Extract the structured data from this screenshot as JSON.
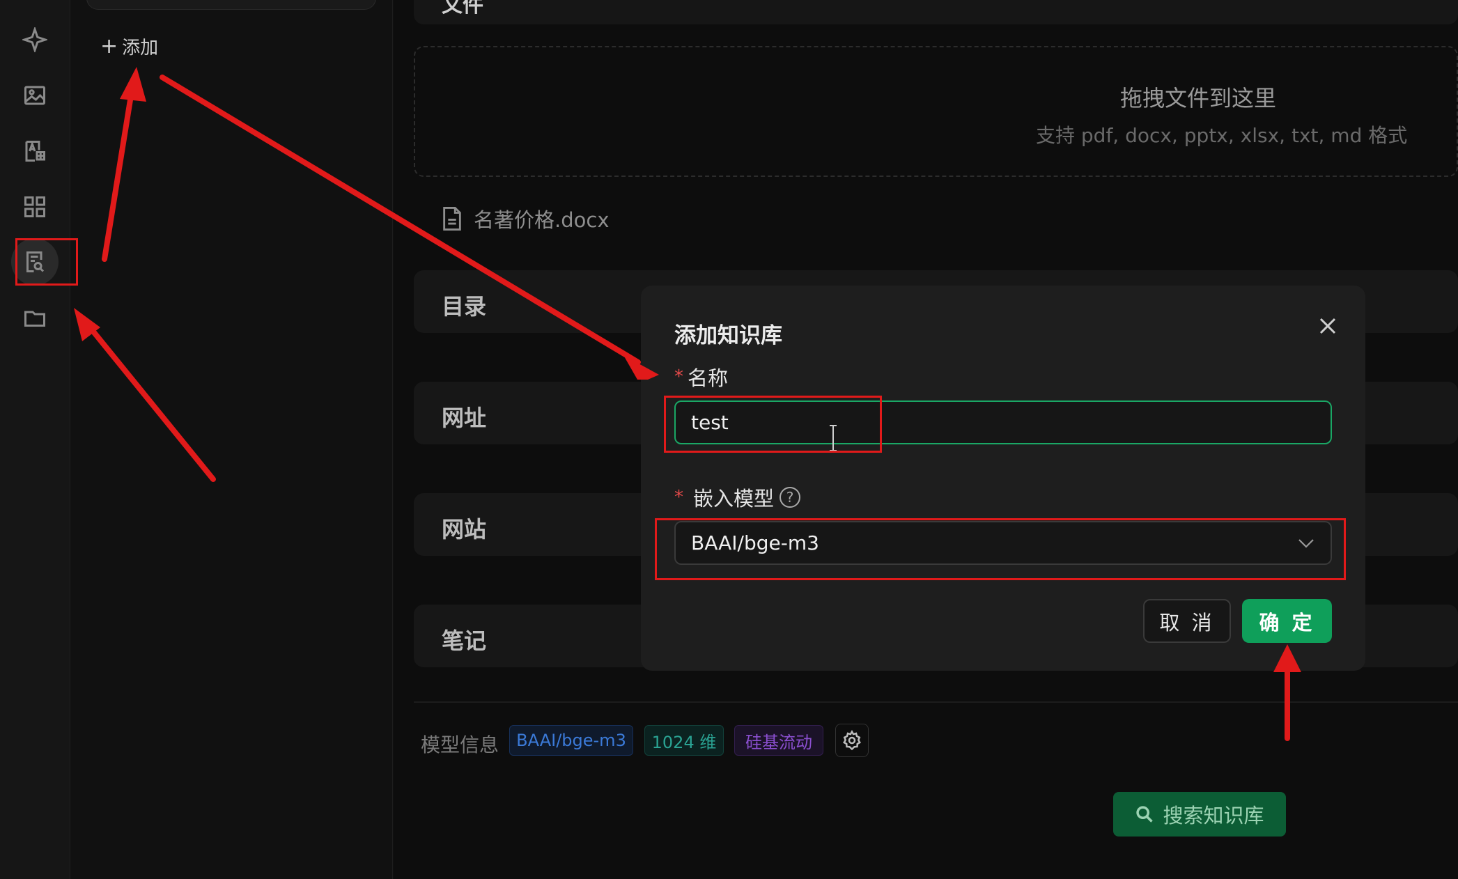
{
  "sidebar": {
    "icons": [
      "sparkle-icon",
      "image-icon",
      "translate-icon",
      "apps-grid-icon",
      "knowledge-base-icon",
      "folder-icon"
    ],
    "add_label": "添加"
  },
  "main": {
    "file_section_title": "文件",
    "dropzone": {
      "title": "拖拽文件到这里",
      "subtitle": "支持 pdf, docx, pptx, xlsx, txt, md 格式"
    },
    "file_name": "名著价格.docx",
    "sections": [
      "目录",
      "网址",
      "网站",
      "笔记"
    ],
    "model_info": {
      "label": "模型信息",
      "model": "BAAI/bge-m3",
      "dimension": "1024 维",
      "provider": "硅基流动"
    },
    "search_button": "搜索知识库"
  },
  "modal": {
    "title": "添加知识库",
    "required_mark": "*",
    "name_label": "名称",
    "name_value": "test",
    "embed_label": "嵌入模型",
    "help_glyph": "?",
    "embed_value": "BAAI/bge-m3",
    "cancel_label": "取 消",
    "ok_label": "确 定"
  },
  "colors": {
    "accent_green": "#0f9f5a",
    "annotation_red": "#e11a1a",
    "tag_blue": "#3b7ad8",
    "tag_teal": "#2aa393",
    "tag_purple": "#8b4fd0"
  }
}
